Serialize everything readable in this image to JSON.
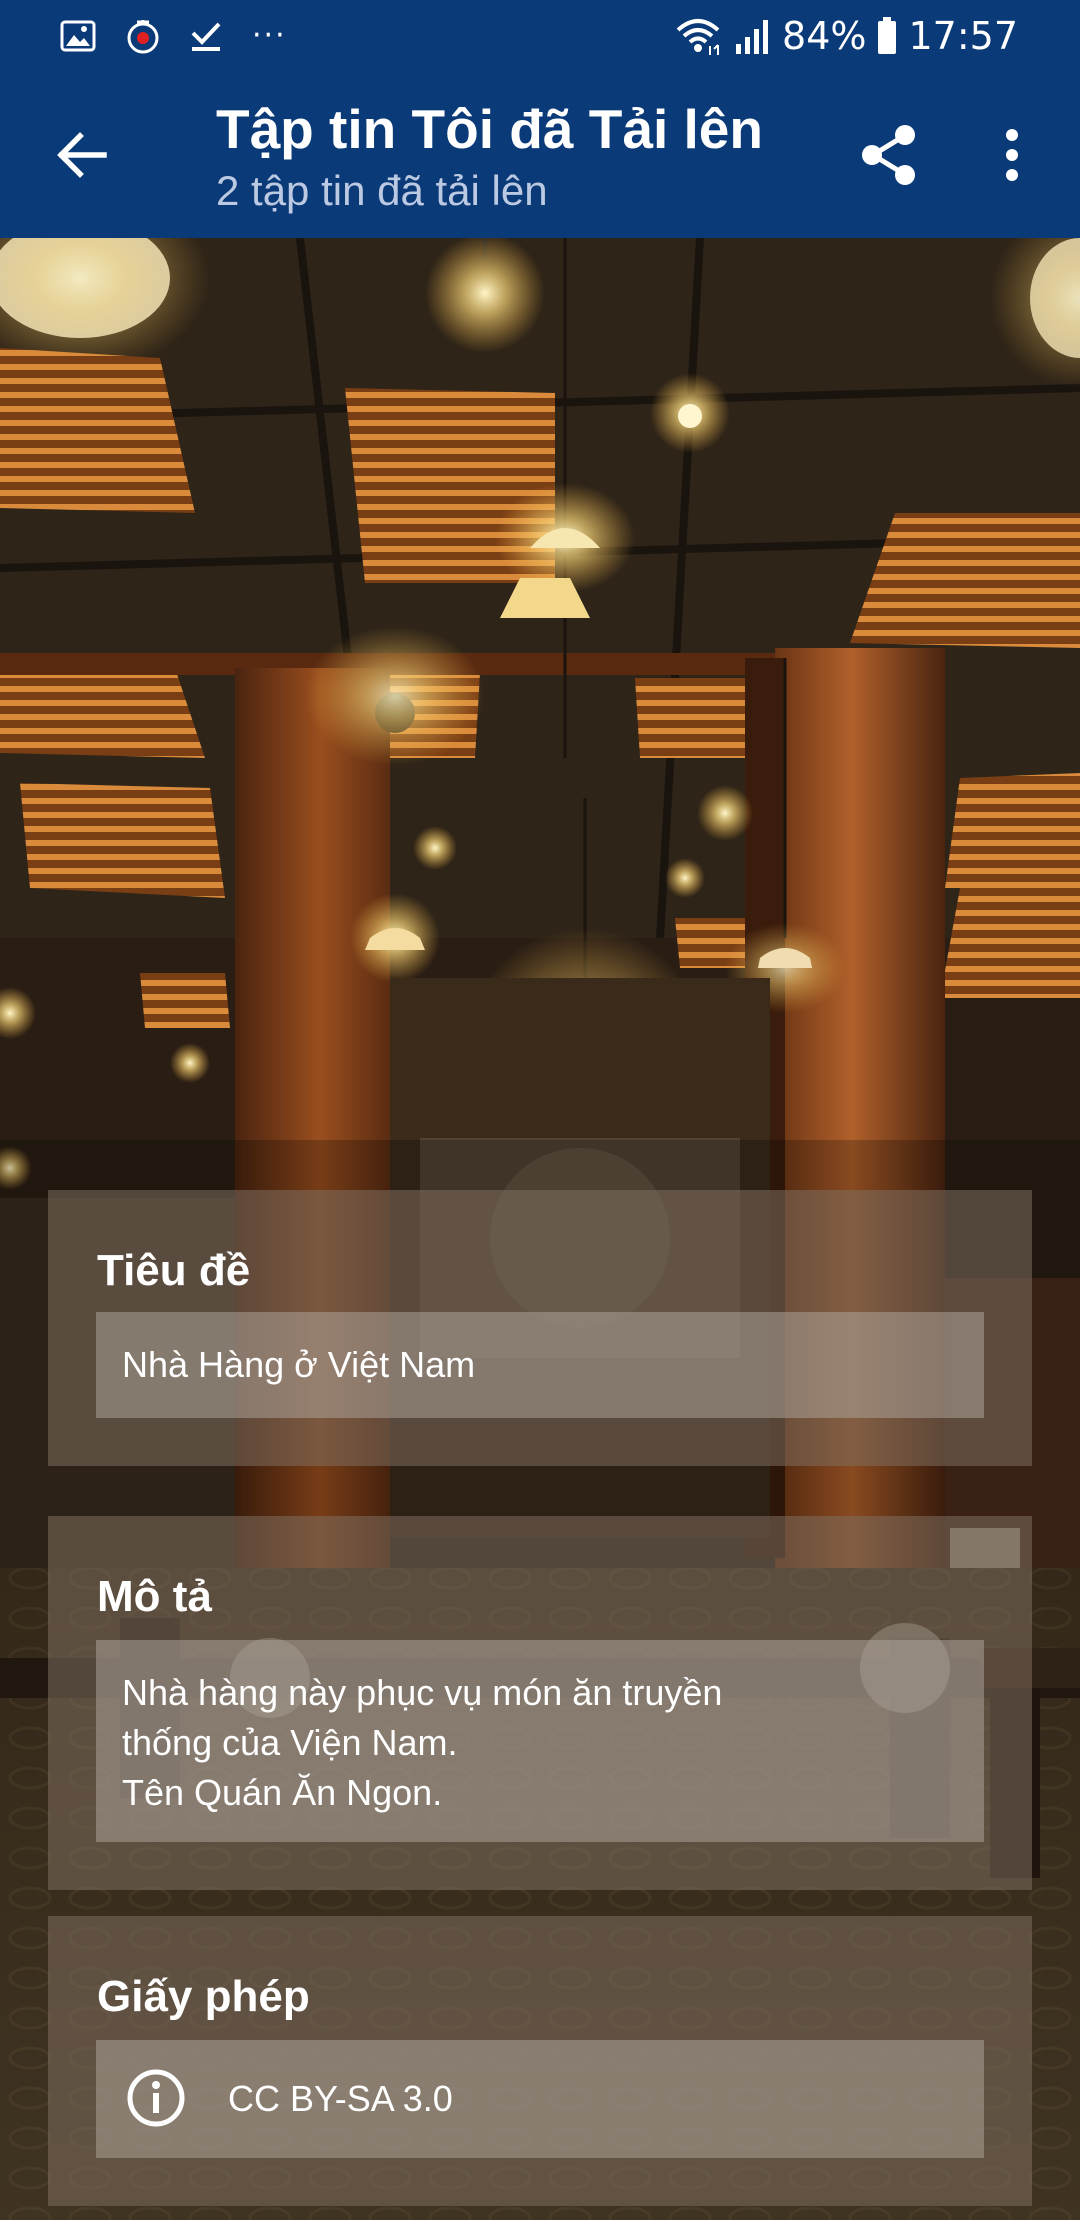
{
  "status_bar": {
    "icons_left": [
      "gallery-icon",
      "app-notification-icon",
      "download-done-icon"
    ],
    "more": "···",
    "battery": "84%",
    "time": "17:57"
  },
  "app_bar": {
    "title": "Tập tin Tôi đã Tải lên",
    "subtitle": "2 tập tin đã tải lên"
  },
  "details": {
    "title_label": "Tiêu đề",
    "title_value": "Nhà Hàng ở Việt Nam",
    "description_label": "Mô tả",
    "description_lines": [
      "Nhà hàng này phục vụ  món ăn truyền",
      "thống của Viện Nam.",
      "Tên Quán Ăn Ngon."
    ],
    "license_label": "Giấy phép",
    "license_value": "CC BY-SA 3.0"
  },
  "colors": {
    "app_bar": "#0a3a78",
    "subtitle": "#bcc9e2",
    "card": "rgba(125,110,95,0.55)"
  }
}
